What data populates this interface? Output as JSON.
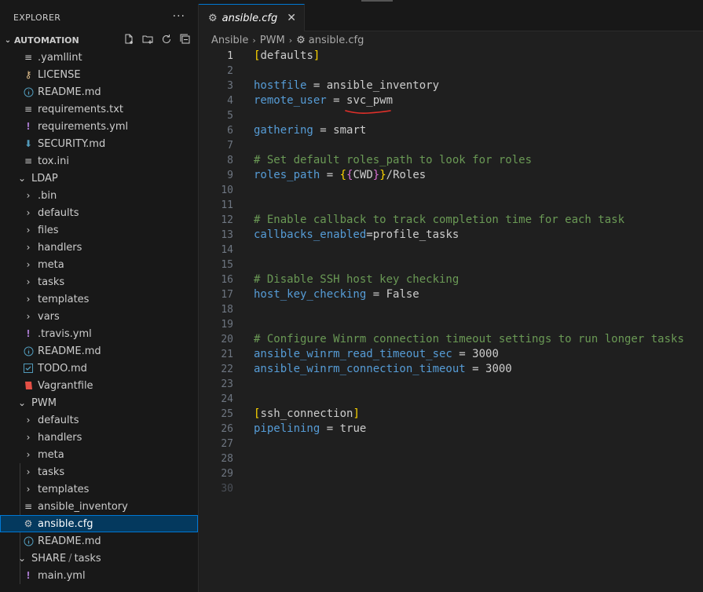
{
  "explorer": {
    "title": "EXPLORER",
    "more": "···",
    "section": "AUTOMATION"
  },
  "tree": {
    "root_files": [
      ".yamllint",
      "LICENSE",
      "README.md",
      "requirements.txt",
      "requirements.yml",
      "SECURITY.md",
      "tox.ini"
    ],
    "ldap": {
      "label": "LDAP",
      "folders": [
        ".bin",
        "defaults",
        "files",
        "handlers",
        "meta",
        "tasks",
        "templates",
        "vars"
      ],
      "files": [
        ".travis.yml",
        "README.md",
        "TODO.md",
        "Vagrantfile"
      ]
    },
    "pwm": {
      "label": "PWM",
      "folders": [
        "defaults",
        "handlers",
        "meta",
        "tasks",
        "templates"
      ],
      "files": [
        "ansible_inventory",
        "ansible.cfg",
        "README.md"
      ]
    },
    "share": {
      "label_a": "SHARE",
      "label_sep": "/",
      "label_b": "tasks",
      "files": [
        "main.yml"
      ]
    }
  },
  "tab": {
    "label": "ansible.cfg",
    "close": "✕"
  },
  "breadcrumb": [
    "Ansible",
    "PWM",
    "ansible.cfg"
  ],
  "code": {
    "active_line": 1,
    "lines": [
      {
        "n": "1",
        "t": ""
      },
      {
        "n": "2",
        "t": ""
      },
      {
        "n": "3",
        "t": ""
      },
      {
        "n": "4",
        "t": ""
      },
      {
        "n": "5",
        "t": ""
      },
      {
        "n": "6",
        "t": ""
      },
      {
        "n": "7",
        "t": ""
      },
      {
        "n": "8",
        "t": ""
      },
      {
        "n": "9",
        "t": ""
      },
      {
        "n": "10",
        "t": ""
      },
      {
        "n": "11",
        "t": ""
      },
      {
        "n": "12",
        "t": ""
      },
      {
        "n": "13",
        "t": ""
      },
      {
        "n": "14",
        "t": ""
      },
      {
        "n": "15",
        "t": ""
      },
      {
        "n": "16",
        "t": ""
      },
      {
        "n": "17",
        "t": ""
      },
      {
        "n": "18",
        "t": ""
      },
      {
        "n": "19",
        "t": ""
      },
      {
        "n": "20",
        "t": ""
      },
      {
        "n": "21",
        "t": ""
      },
      {
        "n": "22",
        "t": ""
      },
      {
        "n": "23",
        "t": ""
      },
      {
        "n": "24",
        "t": ""
      },
      {
        "n": "25",
        "t": ""
      },
      {
        "n": "26",
        "t": ""
      },
      {
        "n": "27",
        "t": ""
      },
      {
        "n": "28",
        "t": ""
      },
      {
        "n": "29",
        "t": ""
      },
      {
        "n": "30",
        "t": ""
      }
    ],
    "segments": {
      "l1_open": "[",
      "l1_name": "defaults",
      "l1_close": "]",
      "l3_key": "hostfile",
      "l3_eq": " = ",
      "l3_val": "ansible_inventory",
      "l4_key": "remote_user",
      "l4_eq": " = ",
      "l4_val": "svc_pwm",
      "l6_key": "gathering",
      "l6_eq": " = ",
      "l6_val": "smart",
      "l8_comment": "# Set default roles_path to look for roles",
      "l9_key": "roles_path",
      "l9_eq": " = ",
      "l9_b1": "{",
      "l9_b2": "{",
      "l9_mid": "CWD",
      "l9_b3": "}",
      "l9_b4": "}",
      "l9_rest": "/Roles",
      "l12_comment": "# Enable callback to track completion time for each task",
      "l13_key": "callbacks_enabled",
      "l13_eq": "=",
      "l13_val": "profile_tasks",
      "l16_comment": "# Disable SSH host key checking",
      "l17_key": "host_key_checking",
      "l17_eq": " = ",
      "l17_val": "False",
      "l20_comment": "# Configure Winrm connection timeout settings to run longer tasks",
      "l21_key": "ansible_winrm_read_timeout_sec",
      "l21_eq": " = ",
      "l21_val": "3000",
      "l22_key": "ansible_winrm_connection_timeout",
      "l22_eq": " = ",
      "l22_val": "3000",
      "l25_open": "[",
      "l25_name": "ssh_connection",
      "l25_close": "]",
      "l26_key": "pipelining",
      "l26_eq": " = ",
      "l26_val": "true"
    }
  },
  "colors": {
    "keyword": "#569cd6",
    "comment": "#6a9955",
    "bracket": "#ffd700",
    "selection": "#04395e",
    "underline": "#e0302a"
  }
}
